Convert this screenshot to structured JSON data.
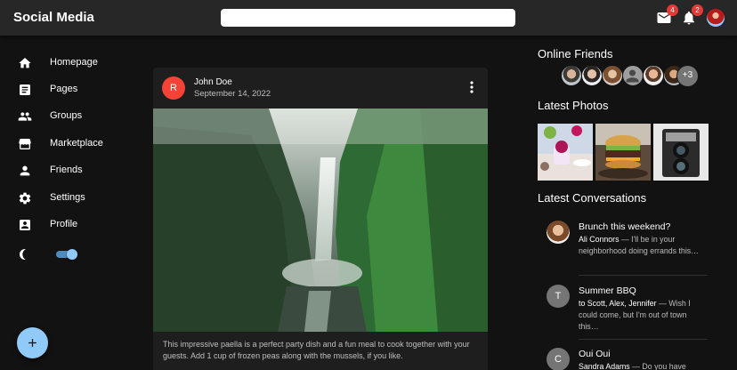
{
  "app": {
    "title": "Social Media",
    "search_value": "",
    "search_placeholder": ""
  },
  "header": {
    "mail_badge": "4",
    "notifications_badge": "2",
    "mail_icon": "mail-icon",
    "bell_icon": "bell-icon"
  },
  "sidebar": {
    "items": [
      {
        "label": "Homepage",
        "icon": "home-icon"
      },
      {
        "label": "Pages",
        "icon": "article-icon"
      },
      {
        "label": "Groups",
        "icon": "group-icon"
      },
      {
        "label": "Marketplace",
        "icon": "storefront-icon"
      },
      {
        "label": "Friends",
        "icon": "person-icon"
      },
      {
        "label": "Settings",
        "icon": "settings-icon"
      },
      {
        "label": "Profile",
        "icon": "account-box-icon"
      }
    ],
    "theme_toggle_on": true
  },
  "post": {
    "avatar_letter": "R",
    "author": "John Doe",
    "date": "September 14, 2022",
    "text": "This impressive paella is a perfect party dish and a fun meal to cook together with your guests. Add 1 cup of frozen peas along with the mussels, if you like."
  },
  "rightbar": {
    "online_friends_heading": "Online Friends",
    "online_friends_more": "+3",
    "latest_photos_heading": "Latest Photos",
    "latest_conversations_heading": "Latest Conversations",
    "conversations": [
      {
        "title": "Brunch this weekend?",
        "sender": "Ali Connors",
        "message": " — I'll be in your neighborhood doing errands this…",
        "avatar_letter": ""
      },
      {
        "title": "Summer BBQ",
        "sender": "to Scott, Alex, Jennifer",
        "message": " — Wish I could come, but I'm out of town this…",
        "avatar_letter": "T"
      },
      {
        "title": "Oui Oui",
        "sender": "Sandra Adams",
        "message": " — Do you have",
        "avatar_letter": "C"
      }
    ]
  },
  "colors": {
    "accent": "#90caf9",
    "badge": "#e53935",
    "avatar_red": "#f44336",
    "background": "#121212",
    "surface": "#1e1e1e"
  }
}
